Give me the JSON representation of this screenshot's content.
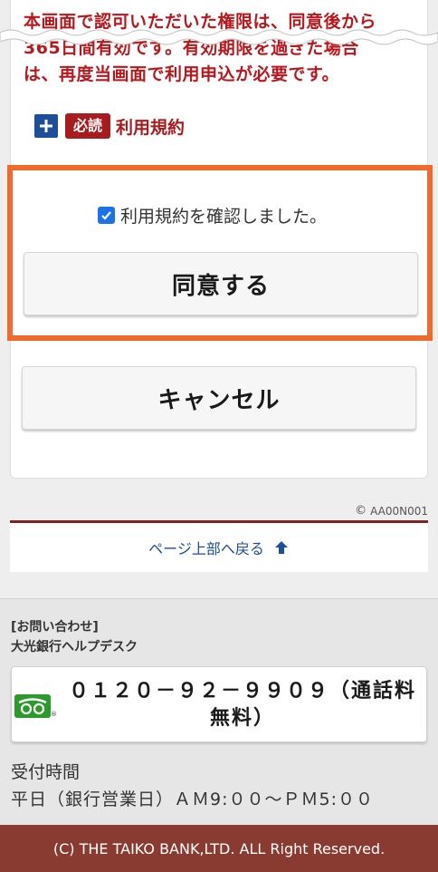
{
  "notice": {
    "line1": "本画面で認可いただいた権限は、同意後から",
    "line2": "365日間有効です。有効期限を過ぎた場合",
    "line3": "は、再度当画面で利用申込が必要です。"
  },
  "terms": {
    "expand_icon": "plus-icon",
    "badge": "必読",
    "link": "利用規約"
  },
  "confirm": {
    "checkbox_checked": true,
    "label": "利用規約を確認しました。"
  },
  "buttons": {
    "agree": "同意する",
    "cancel": "キャンセル"
  },
  "screen_id": "AA00N001",
  "page_top": {
    "label": "ページ上部へ戻る",
    "icon": "arrow-up-icon"
  },
  "contact": {
    "heading": "[お問い合わせ]",
    "desk": "大光銀行ヘルプデスク",
    "phone_line1": "０１２０－９２－９９０９（通話料",
    "phone_line2": "無料）",
    "freedial_icon": "freedial-icon",
    "hours_label": "受付時間",
    "hours_value": "平日（銀行営業日）ＡＭ9:００～ＰＭ5:００"
  },
  "footer": {
    "copyright": "(C) THE TAIKO BANK,LTD. ALL Right Reserved."
  },
  "colors": {
    "notice_red": "#b8181c",
    "badge_red": "#a81b1e",
    "highlight_orange": "#ef6a2c",
    "link_blue": "#1c4e9a",
    "footer_brown": "#8a3b31",
    "freedial_green": "#2a9a2a"
  }
}
